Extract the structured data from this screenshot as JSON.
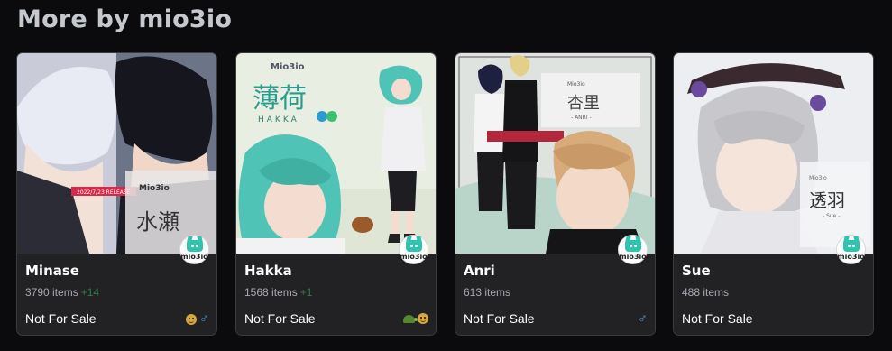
{
  "section_title": "More by mio3io",
  "cards": [
    {
      "name": "Minase",
      "item_count": "3790 items",
      "delta": "+14",
      "sale_status": "Not For Sale",
      "thumb_text": "水瀬",
      "thumb_brand": "Mio3io",
      "thumb_banner": "2022/7/23 RELEASE",
      "tags": [
        "smile-icon",
        "male-icon"
      ]
    },
    {
      "name": "Hakka",
      "item_count": "1568 items",
      "delta": "+1",
      "sale_status": "Not For Sale",
      "thumb_text": "薄荷",
      "thumb_sub": "HAKKA",
      "thumb_brand": "Mio3io",
      "tags": [
        "turtle-icon",
        "smile-icon"
      ]
    },
    {
      "name": "Anri",
      "item_count": "613 items",
      "delta": "",
      "sale_status": "Not For Sale",
      "thumb_text": "杏里",
      "thumb_sub": "- ANRI -",
      "thumb_brand": "Mio3io",
      "tags": [
        "male-icon"
      ]
    },
    {
      "name": "Sue",
      "item_count": "488 items",
      "delta": "",
      "sale_status": "Not For Sale",
      "thumb_text": "透羽",
      "thumb_sub": "- Sue -",
      "thumb_brand": "Mio3io",
      "tags": []
    }
  ],
  "logo_label": "mio3io",
  "colors": {
    "background": "#0b0b0d",
    "card": "#222225",
    "delta": "#2e7d4b",
    "male": "#4d8fd6"
  }
}
